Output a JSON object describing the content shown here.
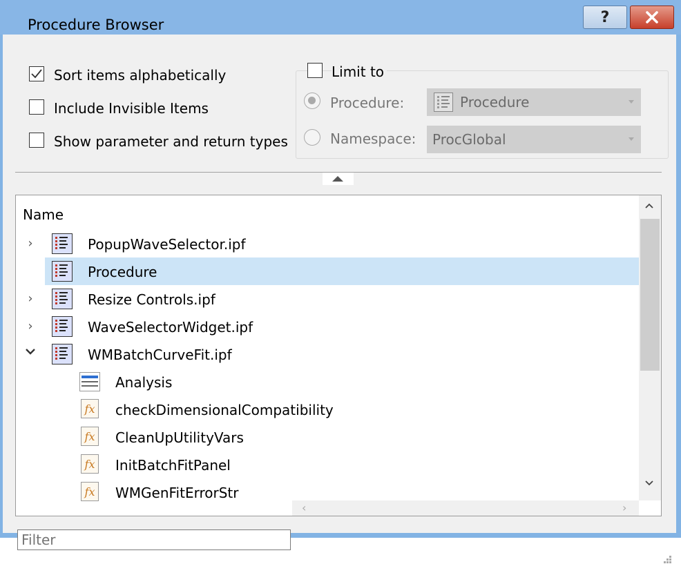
{
  "window": {
    "title": "Procedure Browser",
    "help_glyph": "?",
    "close_glyph": "✕"
  },
  "options": {
    "sort_alphabetically": {
      "label": "Sort items alphabetically",
      "checked": true
    },
    "include_invisible": {
      "label": "Include Invisible Items",
      "checked": false
    },
    "show_types": {
      "label": "Show parameter and return types",
      "checked": false
    }
  },
  "limit": {
    "label": "Limit to",
    "checked": false,
    "procedure_label": "Procedure:",
    "procedure_value": "Procedure",
    "namespace_label": "Namespace:",
    "namespace_value": "ProcGlobal"
  },
  "tree": {
    "column_header": "Name",
    "rows": [
      {
        "label": "PopupWaveSelector.ipf",
        "icon": "procedure-file-icon",
        "expander": "collapsed"
      },
      {
        "label": "Procedure",
        "icon": "procedure-file-icon",
        "expander": "none",
        "selected": true
      },
      {
        "label": "Resize Controls.ipf",
        "icon": "procedure-file-icon",
        "expander": "collapsed"
      },
      {
        "label": "WaveSelectorWidget.ipf",
        "icon": "procedure-file-icon",
        "expander": "collapsed"
      },
      {
        "label": "WMBatchCurveFit.ipf",
        "icon": "procedure-file-icon",
        "expander": "expanded"
      },
      {
        "label": "Analysis",
        "icon": "menu-icon",
        "child": true
      },
      {
        "label": "checkDimensionalCompatibility",
        "icon": "function-icon",
        "child": true
      },
      {
        "label": "CleanUpUtilityVars",
        "icon": "function-icon",
        "child": true
      },
      {
        "label": "InitBatchFitPanel",
        "icon": "function-icon",
        "child": true
      },
      {
        "label": "WMGenFitErrorStr",
        "icon": "function-icon",
        "child": true
      }
    ],
    "fx_glyph": "fx",
    "chevron_right": "›",
    "chevron_down": "⌄",
    "scroll_up": "⌃",
    "scroll_down": "⌄",
    "scroll_left": "‹",
    "scroll_right": "›"
  },
  "filter": {
    "placeholder": "Filter",
    "value": ""
  }
}
